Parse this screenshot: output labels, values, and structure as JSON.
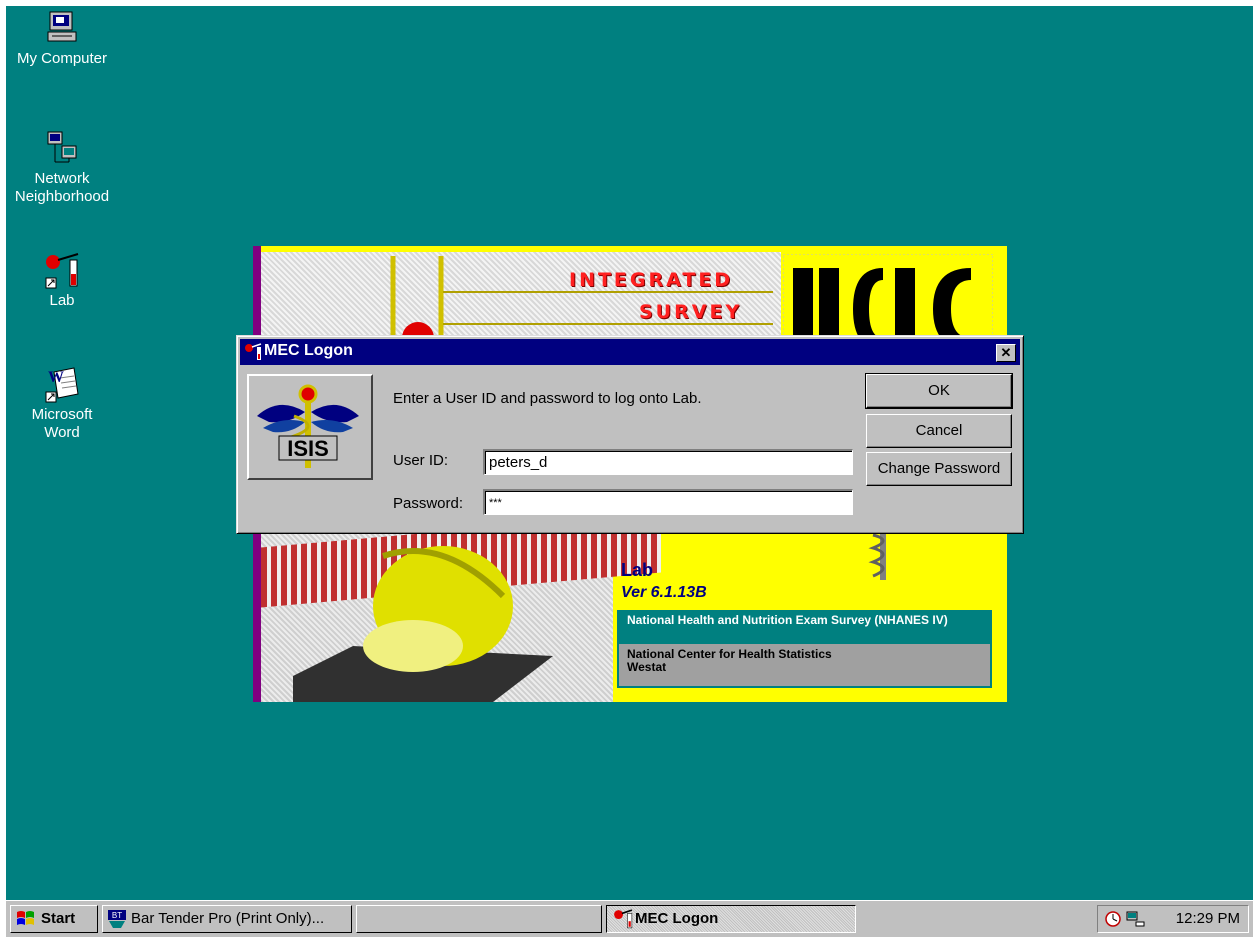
{
  "desktop": {
    "icons": [
      {
        "label": "My Computer",
        "icon": "computer-icon"
      },
      {
        "label": "Network Neighborhood",
        "icon": "network-icon"
      },
      {
        "label": "Lab",
        "icon": "lab-shortcut-icon"
      },
      {
        "label": "Microsoft Word",
        "icon": "word-shortcut-icon"
      }
    ]
  },
  "splash": {
    "title_line1": "INTEGRATED",
    "title_line2": "SURVEY",
    "app_name": "Lab",
    "version": "Ver 6.1.13B",
    "info_line1": "National Health and Nutrition Exam Survey (NHANES IV)",
    "info_line2": "National Center for Health Statistics",
    "info_line3": "Westat"
  },
  "dialog": {
    "title": "MEC Logon",
    "close_label": "✕",
    "logo_text": "ISIS",
    "prompt": "Enter a User ID and password to log onto Lab.",
    "user_id_label": "User ID:",
    "user_id_value": "peters_d",
    "password_label": "Password:",
    "password_value": "***",
    "ok_label": "OK",
    "cancel_label": "Cancel",
    "change_password_label": "Change Password"
  },
  "taskbar": {
    "start_label": "Start",
    "tasks": [
      {
        "label": "Bar Tender Pro (Print Only)..."
      },
      {
        "label": ""
      },
      {
        "label": "MEC Logon"
      }
    ],
    "clock": "12:29 PM"
  },
  "colors": {
    "desktop": "#008080",
    "title_bar": "#000080",
    "splash_bg": "#ffff00"
  }
}
